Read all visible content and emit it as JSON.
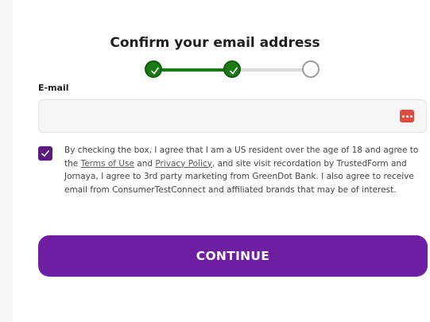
{
  "form": {
    "title": "Confirm your email address",
    "progress": {
      "completed_steps": 2,
      "total_steps": 3
    },
    "email_label": "E-mail",
    "email_value": "",
    "consent": {
      "checked": true,
      "text_1": "By checking the box, I agree that I am a US resident over the age of 18 and agree to the ",
      "terms_link": "Terms of Use",
      "text_2": " and ",
      "privacy_link": "Privacy Policy",
      "text_3": ", and site visit recordation by TrustedForm and Jornaya, I agree to 3rd party marketing from GreenDot Bank. I also agree to receive email from ConsumerTestConnect and affiliated brands that may be of interest."
    },
    "continue_label": "CONTINUE"
  },
  "colors": {
    "step_done": "#1a7a14",
    "accent": "#6e1ea0",
    "checkbox": "#5a1a7e",
    "password_manager_icon": "#e04b3f"
  },
  "icons": [
    "check-icon",
    "password-manager-icon"
  ]
}
